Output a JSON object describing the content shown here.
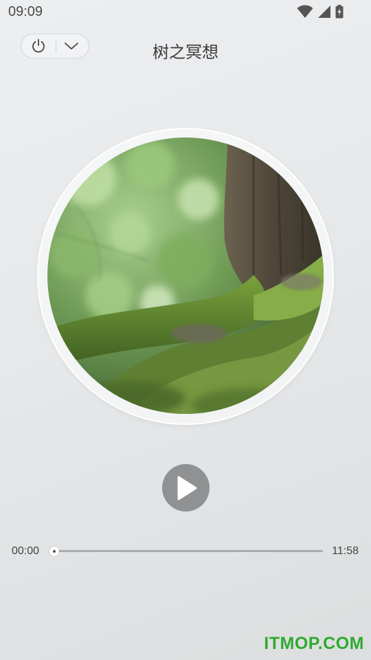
{
  "status_bar": {
    "time": "09:09",
    "icons": [
      "wifi-icon",
      "cell-signal-icon",
      "battery-charging-icon"
    ]
  },
  "header": {
    "title": "树之冥想",
    "buttons": [
      "power-icon",
      "chevron-down-icon"
    ]
  },
  "player": {
    "current_time": "00:00",
    "total_time": "11:58",
    "progress": 0,
    "state": "paused",
    "play_icon": "play-icon"
  },
  "watermark": "ITMOP.COM",
  "colors": {
    "play_button": "#8f9193",
    "seek_track": "#a9abad",
    "watermark": "#2faa2f"
  }
}
